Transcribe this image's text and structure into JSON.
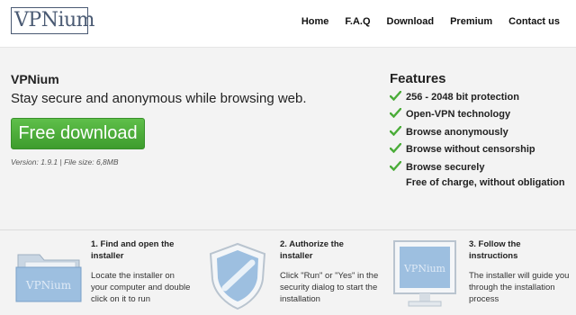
{
  "header": {
    "logo": "VPNium",
    "nav": [
      "Home",
      "F.A.Q",
      "Download",
      "Premium",
      "Contact us"
    ]
  },
  "hero": {
    "title": "VPNium",
    "subtitle": "Stay secure and anonymous while browsing web.",
    "download_label": "Free download",
    "version": "Version: 1.9.1 | File size: 6,8MB"
  },
  "features": {
    "title": "Features",
    "items": [
      "256 - 2048 bit protection",
      "Open-VPN technology",
      "Browse anonymously",
      "Browse without censorship",
      "Browse securely"
    ],
    "extra": "Free of charge, without obligation"
  },
  "steps": [
    {
      "title_line1": "1. Find and open the",
      "title_line2": "installer",
      "text_line1": "Locate the installer on",
      "text_line2": "your computer and double",
      "text_line3": "click on it to run",
      "icon_label": "VPNium"
    },
    {
      "title_line1": "2. Authorize the",
      "title_line2": "installer",
      "text_line1": "Click \"Run\" or \"Yes\" in the",
      "text_line2": "security dialog to start the",
      "text_line3": "installation"
    },
    {
      "title_line1": "3. Follow the",
      "title_line2": "instructions",
      "text_line1": "The installer will guide you",
      "text_line2": "through the installation",
      "text_line3": "process",
      "icon_label": "VPNium"
    }
  ],
  "colors": {
    "accent_green": "#4aac38",
    "logo": "#4a5a73",
    "icon_blue": "#8fb3d6"
  }
}
